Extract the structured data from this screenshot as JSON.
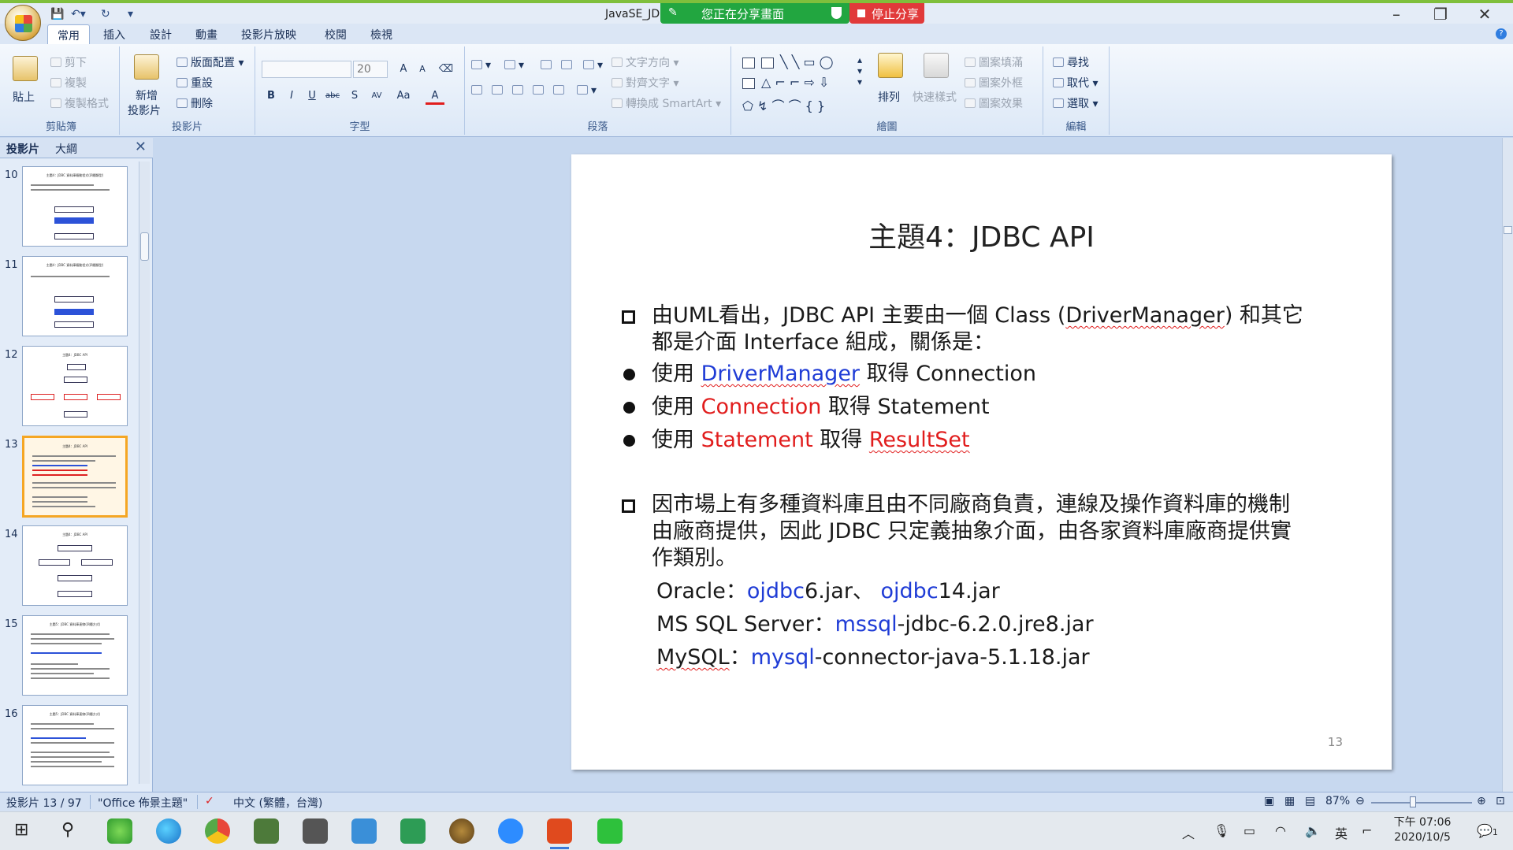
{
  "window": {
    "title": "JavaSE_JD",
    "share_banner": "您正在分享畫面",
    "stop_share": "停止分享"
  },
  "tabs": [
    "常用",
    "插入",
    "設計",
    "動畫",
    "投影片放映",
    "校閱",
    "檢視"
  ],
  "ribbon": {
    "clipboard": {
      "label": "剪貼簿",
      "paste": "貼上",
      "cut": "剪下",
      "copy": "複製",
      "format_painter": "複製格式"
    },
    "slides": {
      "label": "投影片",
      "new_slide_1": "新增",
      "new_slide_2": "投影片",
      "layout": "版面配置",
      "reset": "重設",
      "delete": "刪除"
    },
    "font": {
      "label": "字型",
      "size": "20",
      "bold": "B",
      "italic": "I",
      "underline": "U",
      "strike": "abc",
      "shadow": "S",
      "spacing": "AV",
      "case": "Aa",
      "color": "A",
      "grow": "A",
      "shrink": "A"
    },
    "paragraph": {
      "label": "段落",
      "text_direction": "文字方向",
      "align_text": "對齊文字",
      "smartart": "轉換成 SmartArt"
    },
    "drawing": {
      "label": "繪圖",
      "arrange": "排列",
      "quick_styles": "快速樣式",
      "shape_fill": "圖案填滿",
      "shape_outline": "圖案外框",
      "shape_effects": "圖案效果"
    },
    "editing": {
      "label": "編輯",
      "find": "尋找",
      "replace": "取代",
      "select": "選取"
    }
  },
  "left_pane": {
    "tab_slides": "投影片",
    "tab_outline": "大綱",
    "close": "✕",
    "thumbnails": [
      {
        "num": "10",
        "title": "主題4：JDBC 資料庫驅動程式(四種類型)"
      },
      {
        "num": "11",
        "title": "主題4：JDBC 資料庫驅動程式(四種類型)"
      },
      {
        "num": "12",
        "title": "主題4：JDBC API"
      },
      {
        "num": "13",
        "title": "主題4：JDBC API"
      },
      {
        "num": "14",
        "title": "主題4：JDBC API"
      },
      {
        "num": "15",
        "title": "主題5：JDBC 資料庫連線(四種方式)"
      },
      {
        "num": "16",
        "title": "主題5：JDBC 資料庫連線(四種方式)"
      }
    ]
  },
  "slide": {
    "title": "主題4：JDBC API",
    "para1_line1": "由UML看出，JDBC API 主要由一個 Class (",
    "para1_dm": "DriverManager",
    "para1_line1_end": ") 和其它",
    "para1_line2": "都是介面 Interface 組成，關係是：",
    "b1_pre": "使用 ",
    "b1_key": "DriverManager",
    "b1_post": " 取得 Connection",
    "b2_pre": "使用 ",
    "b2_key": "Connection",
    "b2_post": " 取得 Statement",
    "b3_pre": "使用 ",
    "b3_key": "Statement",
    "b3_mid": " 取得 ",
    "b3_key2": "ResultSet",
    "para2_line1": "因市場上有多種資料庫且由不同廠商負責，連線及操作資料庫的機制",
    "para2_line2": "由廠商提供，因此 JDBC 只定義抽象介面，由各家資料庫廠商提供實",
    "para2_line3": "作類別。",
    "oracle_pre": "Oracle：",
    "oracle_k1": "ojdbc",
    "oracle_m1": "6.jar、 ",
    "oracle_k2": "ojdbc",
    "oracle_m2": "14.jar",
    "mssql_pre": "MS SQL Server：",
    "mssql_k": "mssql",
    "mssql_post": "-jdbc-6.2.0.jre8.jar",
    "mysql_pre": "MySQL",
    "mysql_colon": "：",
    "mysql_k": "mysql",
    "mysql_post": "-connector-java-5.1.18.jar",
    "page_number": "13"
  },
  "status": {
    "slide_pos": "投影片 13 / 97",
    "theme": "\"Office 佈景主題\"",
    "language": "中文 (繁體，台灣)",
    "zoom": "87%"
  },
  "taskbar": {
    "time": "下午 07:06",
    "date": "2020/10/5",
    "ime": "英",
    "notifications": "1"
  },
  "colors": {
    "accent_blue": "#1f3cd6",
    "accent_red": "#e11d1d",
    "share_green": "#22a640",
    "stop_red": "#e13a3a"
  }
}
